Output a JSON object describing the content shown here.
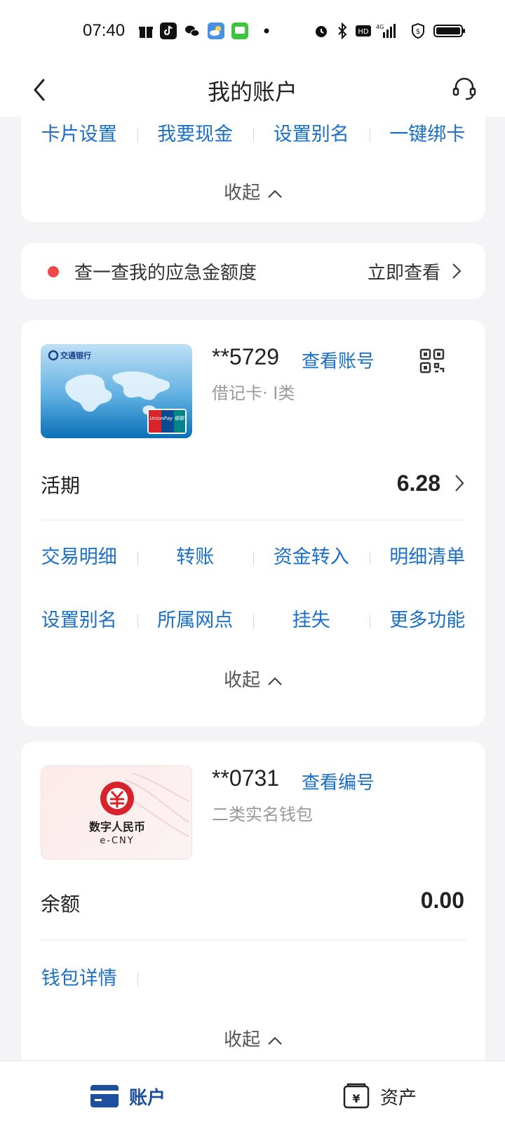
{
  "status_bar": {
    "time": "07:40"
  },
  "nav": {
    "title": "我的账户"
  },
  "top_card": {
    "actions": [
      "卡片设置",
      "我要现金",
      "设置别名",
      "一键绑卡"
    ],
    "collapse": "收起"
  },
  "emergency": {
    "text": "查一查我的应急金额度",
    "link": "立即查看"
  },
  "debit_card": {
    "account": "**5729",
    "view_link": "查看账号",
    "type": "借记卡· I类",
    "balance_label": "活期",
    "balance": "6.28",
    "actions_row1": [
      "交易明细",
      "转账",
      "资金转入",
      "明细清单"
    ],
    "actions_row2": [
      "设置别名",
      "所属网点",
      "挂失",
      "更多功能"
    ],
    "collapse": "收起",
    "card_image": {
      "bank": "交通银行",
      "network": "UnionPay 银联"
    }
  },
  "ecny_card": {
    "account": "**0731",
    "view_link": "查看编号",
    "type": "二类实名钱包",
    "balance_label": "余额",
    "balance": "0.00",
    "actions": [
      "钱包详情"
    ],
    "collapse": "收起",
    "card_image": {
      "logo_cn": "数字人民币",
      "logo_en": "e-CNY"
    }
  },
  "tabbar": {
    "tabs": [
      {
        "label": "账户",
        "active": true
      },
      {
        "label": "资产",
        "active": false
      }
    ]
  },
  "colors": {
    "accent": "#1a6fc8",
    "tab_active": "#1d4f9e",
    "dot": "#f04848"
  }
}
